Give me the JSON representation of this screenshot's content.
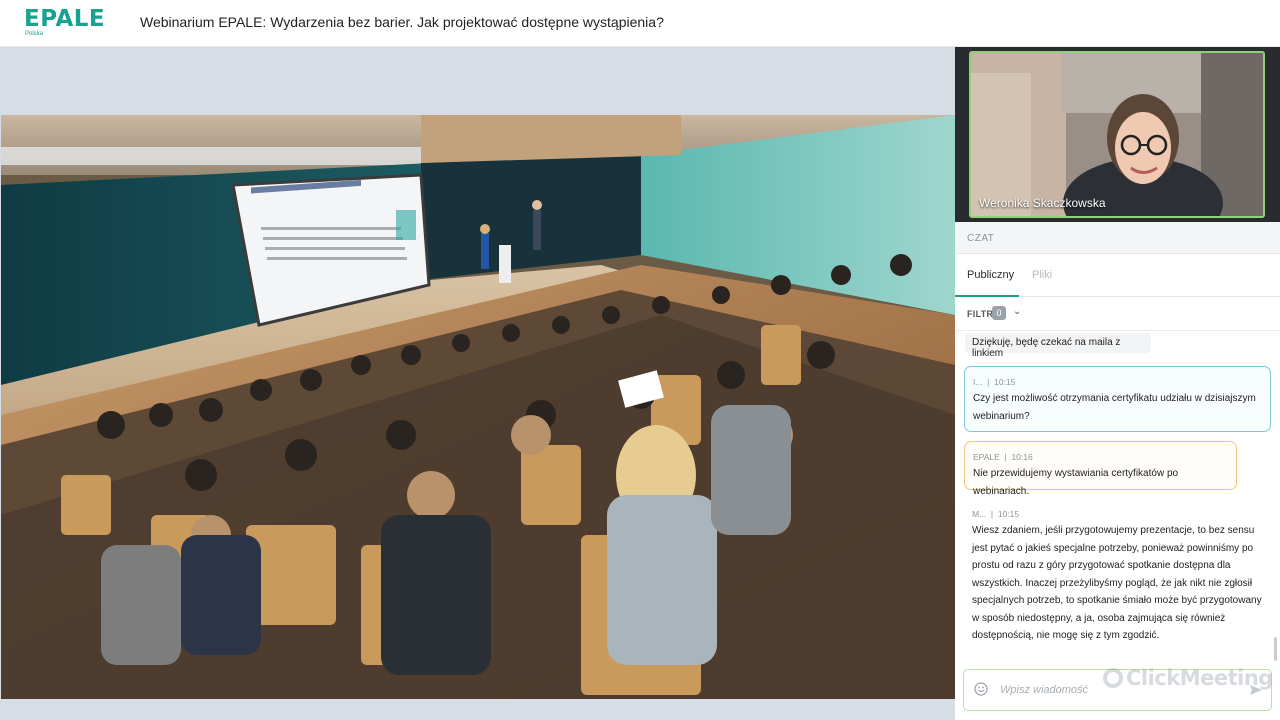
{
  "header": {
    "logo_text": "EPALE",
    "logo_sub": "Polska",
    "title": "Webinarium EPALE: Wydarzenia bez barier. Jak projektować dostępne wystąpienia?"
  },
  "presenter": {
    "name": "Weronika Skaczkowska"
  },
  "chat": {
    "section_label": "CZAT",
    "tabs": [
      {
        "label": "Publiczny",
        "active": true
      },
      {
        "label": "Pliki",
        "active": false
      }
    ],
    "filter_label": "FILTR",
    "filter_count": "0",
    "messages": [
      {
        "author": "",
        "time": "",
        "text": "Dziękuję, będę czekać na maila z linkiem"
      },
      {
        "author": "I...",
        "time": "10:15",
        "text": "Czy jest możliwość otrzymania certyfikatu udziału w dzisiajszym webinarium?"
      },
      {
        "author": "EPALE",
        "time": "10:16",
        "text": "Nie przewidujemy wystawiania certyfikatów po webinariach."
      },
      {
        "author": "M...",
        "time": "10:15",
        "text": "Wiesz zdaniem, jeśli przygotowujemy prezentacje, to bez sensu jest pytać o jakieś specjalne potrzeby, ponieważ powinniśmy po prostu od razu z góry przygotować spotkanie dostępna dla wszystkich. Inaczej przeżylibyśmy pogląd, że jak nikt nie zgłosił specjalnych potrzeb, to spotkanie śmiało może być przygotowany w sposób niedostępny, a ja, osoba zajmująca się również dostępnością, nie mogę się z tym zgodzić."
      }
    ],
    "input_placeholder": "Wpisz wiadomość",
    "watermark": "ClickMeeting"
  },
  "colors": {
    "brand": "#18a28f",
    "speaker_border": "#8fd07a",
    "question_border": "#7ec8d7",
    "host_border": "#f1c77f"
  }
}
